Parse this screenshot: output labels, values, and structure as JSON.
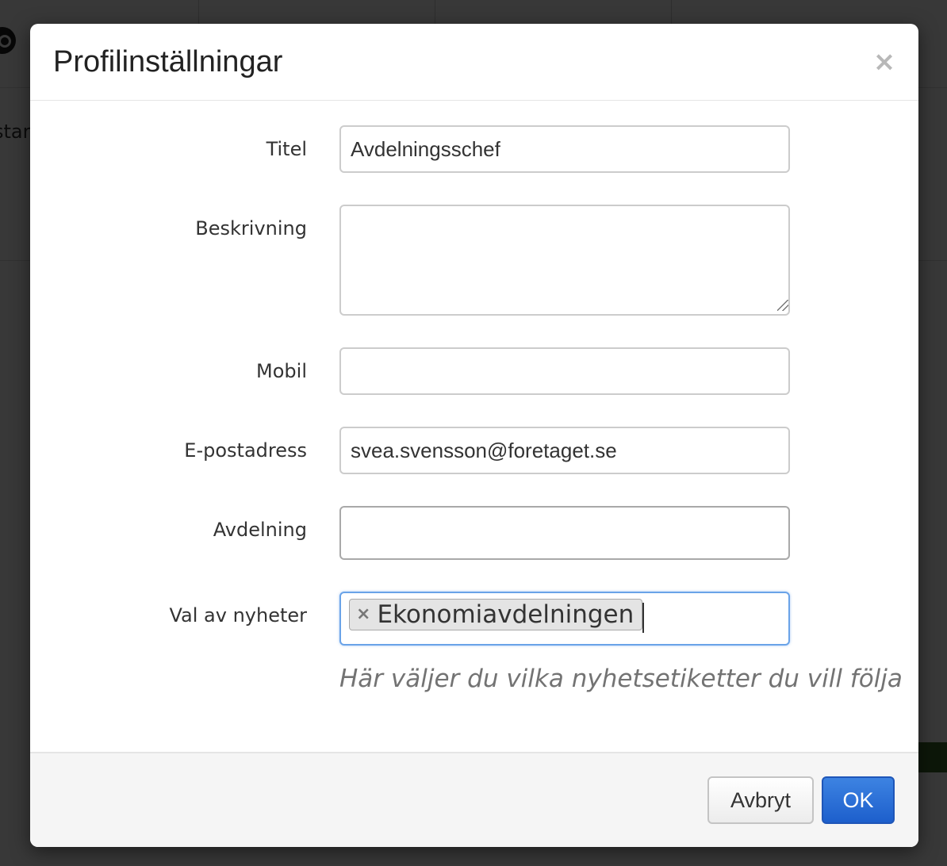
{
  "background": {
    "crumb_fragment": "start",
    "logo_icon": "logo-circle-icon"
  },
  "dialog": {
    "title": "Profilinställningar",
    "close_glyph": "×",
    "close_icon": "close-icon"
  },
  "form": {
    "titel": {
      "label": "Titel",
      "value": "Avdelningsschef"
    },
    "beskrivning": {
      "label": "Beskrivning",
      "value": ""
    },
    "mobil": {
      "label": "Mobil",
      "value": ""
    },
    "epost": {
      "label": "E-postadress",
      "value": "svea.svensson@foretaget.se"
    },
    "avdelning": {
      "label": "Avdelning",
      "value": ""
    },
    "nyheter": {
      "label": "Val av nyheter",
      "tags": [
        {
          "label": "Ekonomiavdelningen",
          "remove_glyph": "×"
        }
      ],
      "help": "Här väljer du vilka nyhetsetiketter du vill följa"
    }
  },
  "footer": {
    "cancel_label": "Avbryt",
    "ok_label": "OK"
  },
  "colors": {
    "primary": "#1d5fcc",
    "focus_border": "#6aa3e8",
    "footer_bg": "#f5f5f5"
  }
}
